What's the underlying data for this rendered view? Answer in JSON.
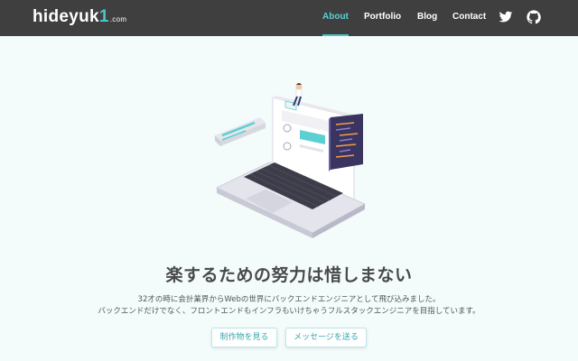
{
  "header": {
    "brand": {
      "main": "hideyuk",
      "accent": "1",
      "suffix": ".com"
    },
    "nav": [
      {
        "label": "About",
        "active": true
      },
      {
        "label": "Portfolio",
        "active": false
      },
      {
        "label": "Blog",
        "active": false
      },
      {
        "label": "Contact",
        "active": false
      }
    ],
    "icons": [
      "twitter-icon",
      "github-icon"
    ]
  },
  "hero": {
    "headline": "楽するための努力は惜しまない",
    "lines": [
      "32才の時に会計業界からWebの世界にバックエンドエンジニアとして飛び込みました。",
      "バックエンドだけでなく、フロントエンドもインフラもいけちゃうフルスタックエンジニアを目指しています。"
    ],
    "buttons": [
      {
        "label": "制作物を見る"
      },
      {
        "label": "メッセージを送る"
      }
    ]
  },
  "colors": {
    "accent": "#4fc3c8",
    "navbar": "#3f3f3f",
    "background": "#f3fbfb"
  }
}
